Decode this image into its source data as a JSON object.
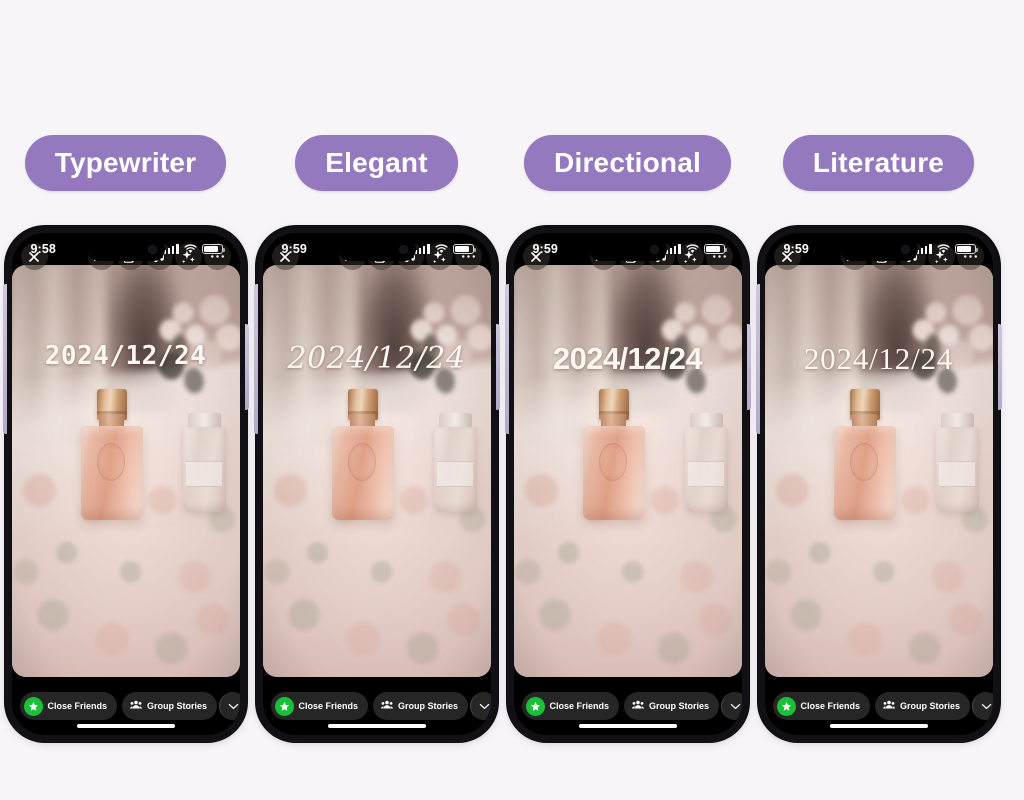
{
  "background_color": "#f7f5f8",
  "accent_color": "#9479bf",
  "labels": [
    {
      "text": "Typewriter"
    },
    {
      "text": "Elegant"
    },
    {
      "text": "Directional"
    },
    {
      "text": "Literature"
    }
  ],
  "phones": [
    {
      "style": "typewriter",
      "status": {
        "time": "9:58"
      },
      "date_sticker": "2024/12/24"
    },
    {
      "style": "elegant",
      "status": {
        "time": "9:59"
      },
      "date_sticker": "2024/12/24"
    },
    {
      "style": "directional",
      "status": {
        "time": "9:59"
      },
      "date_sticker": "2024/12/24"
    },
    {
      "style": "literature",
      "status": {
        "time": "9:59"
      },
      "date_sticker": "2024/12/24"
    }
  ],
  "story_toolbar": {
    "close_icon": "close-icon",
    "buttons": [
      {
        "icon": "text-aa-icon",
        "label": "Aa"
      },
      {
        "icon": "sticker-icon",
        "label": ""
      },
      {
        "icon": "music-note-icon",
        "label": ""
      },
      {
        "icon": "sparkles-icon",
        "label": ""
      },
      {
        "icon": "more-ellipsis-icon",
        "label": "···"
      }
    ]
  },
  "share_bar": {
    "close_friends_label": "Close Friends",
    "close_friends_icon": "green-star-icon",
    "group_stories_label": "Group Stories",
    "group_stories_icon": "group-people-icon",
    "expand_icon": "chevron-down-icon",
    "send_icon": "arrow-right-icon"
  },
  "status_icons": {
    "cellular": "signal-bars-icon",
    "wifi": "wifi-icon",
    "battery": "battery-icon"
  }
}
